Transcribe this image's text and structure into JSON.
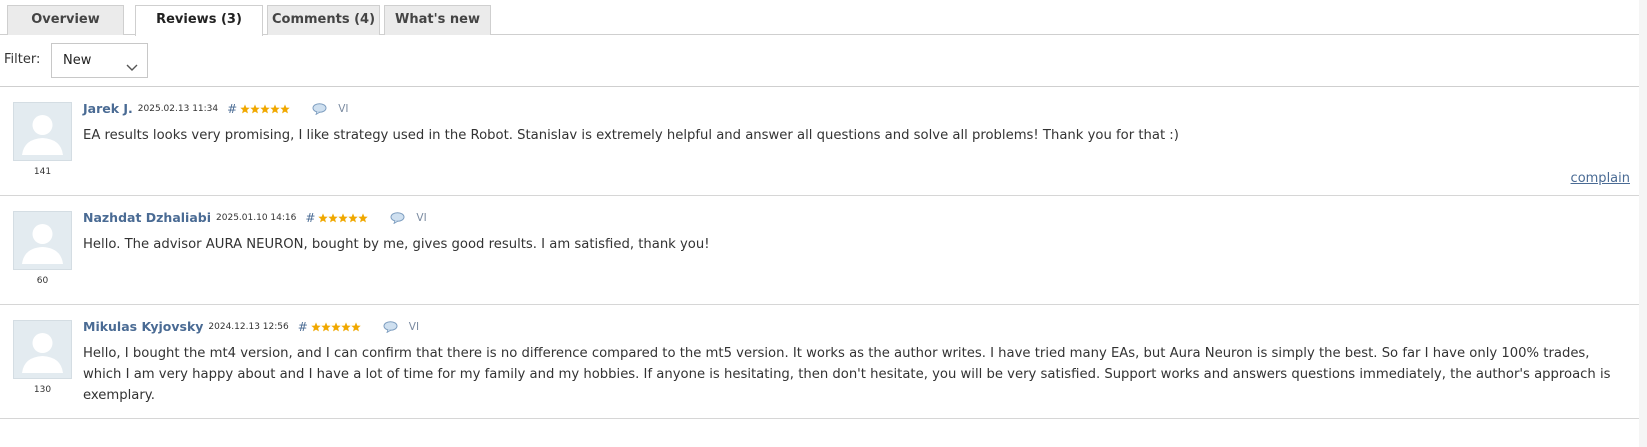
{
  "tabs": [
    {
      "label": "Overview",
      "active": false
    },
    {
      "label": "Reviews (3)",
      "active": true
    },
    {
      "label": "Comments (4)",
      "active": false
    },
    {
      "label": "What's new",
      "active": false
    }
  ],
  "filter": {
    "label": "Filter:",
    "selected": "New"
  },
  "reviews": [
    {
      "author": "Jarek J.",
      "date": "2025.02.13 11:34",
      "hash": "#",
      "stars": 5,
      "lang": "VI",
      "rating": "141",
      "text": "EA results looks very promising, I like strategy used in the Robot. Stanislav is extremely helpful and answer all questions and solve all problems! Thank you for that :)",
      "complain": "complain"
    },
    {
      "author": "Nazhdat Dzhaliabi",
      "date": "2025.01.10 14:16",
      "hash": "#",
      "stars": 5,
      "lang": "VI",
      "rating": "60",
      "text": "Hello. The advisor AURA NEURON, bought by me, gives good results. I am satisfied, thank you!"
    },
    {
      "author": "Mikulas Kyjovsky",
      "date": "2024.12.13 12:56",
      "hash": "#",
      "stars": 5,
      "lang": "VI",
      "rating": "130",
      "text": "Hello, I bought the mt4 version, and I can confirm that there is no difference compared to the mt5 version. It works as the author writes. I have tried many EAs, but Aura Neuron is simply the best. So far I have only 100% trades, which I am very happy about and I have a lot of time for my family and my hobbies. If anyone is hesitating, then don't hesitate, you will be very satisfied. Support works and answers questions immediately, the author's approach is exemplary."
    }
  ],
  "colors": {
    "link": "#4a6b94",
    "star": "#f0a800",
    "tab_bg": "#ebebeb",
    "border": "#cfcfcf"
  }
}
